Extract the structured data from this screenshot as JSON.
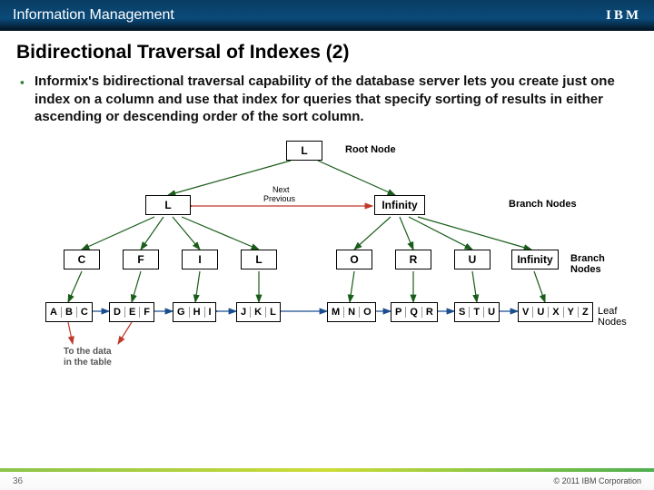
{
  "header": {
    "title": "Information Management",
    "logo": "IBM"
  },
  "title": "Bidirectional Traversal of Indexes (2)",
  "body": "Informix's bidirectional traversal capability of the database server lets you create just one index on a column and use that index for queries that specify sorting of results in either ascending or descending order of the sort column.",
  "diagram": {
    "root": "L",
    "labels": {
      "root": "Root Node",
      "branch": "Branch Nodes",
      "leaf": "Leaf Nodes"
    },
    "nav": {
      "next": "Next",
      "prev": "Previous"
    },
    "branch1": [
      "L",
      "Infinity"
    ],
    "branch2": [
      "C",
      "F",
      "I",
      "L",
      "O",
      "R",
      "U",
      "Infinity"
    ],
    "leaves": [
      [
        "A",
        "B",
        "C"
      ],
      [
        "D",
        "E",
        "F"
      ],
      [
        "G",
        "H",
        "I"
      ],
      [
        "J",
        "K",
        "L"
      ],
      [
        "M",
        "N",
        "O"
      ],
      [
        "P",
        "Q",
        "R"
      ],
      [
        "S",
        "T",
        "U"
      ],
      [
        "V",
        "U",
        "X",
        "Y",
        "Z"
      ]
    ],
    "table_note": "To the data\nin the table"
  },
  "footer": {
    "page": "36",
    "copyright": "© 2011 IBM Corporation"
  }
}
